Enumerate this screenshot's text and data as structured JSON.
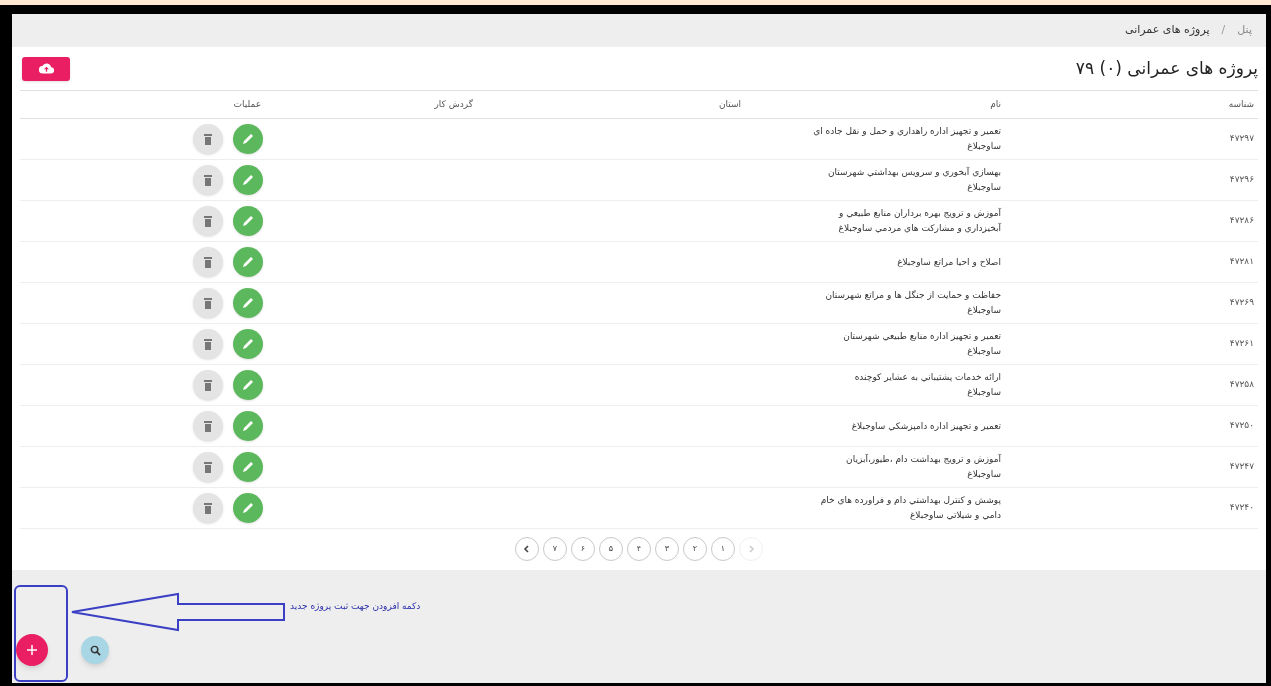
{
  "breadcrumb": [
    {
      "label": "پنل"
    },
    {
      "label": "پروژه های عمرانی",
      "separator": "/"
    }
  ],
  "title": "پروژه های عمرانی (۰) ۷۹",
  "table": {
    "columns": [
      "شناسه",
      "نام",
      "استان",
      "گردش کار",
      "عملیات"
    ],
    "rows": [
      {
        "id": "۴۷۲۹۷",
        "name_lines": [
          "تعمیر و تجهیز اداره راهداري و حمل و نقل جاده اي",
          "ساوجبلاغ"
        ]
      },
      {
        "id": "۴۷۲۹۶",
        "name_lines": [
          "بهسازي آبخوري و سرويس بهداشتي شهرستان",
          "ساوجبلاغ"
        ]
      },
      {
        "id": "۴۷۲۸۶",
        "name_lines": [
          "آموزش و ترويج بهره برداران منابع طبيعي و",
          "آبخيزداري و مشاركت هاي مردمي ساوجبلاغ"
        ]
      },
      {
        "id": "۴۷۲۸۱",
        "name_lines": [
          "اصلاح و احيا مراتع ساوجبلاغ"
        ]
      },
      {
        "id": "۴۷۲۶۹",
        "name_lines": [
          "حفاظت و حمايت از جنگل ها و مراتع شهرستان",
          "ساوجبلاغ"
        ]
      },
      {
        "id": "۴۷۲۶۱",
        "name_lines": [
          "تعمير و تجهيز اداره منابع طبيعي شهرستان",
          "ساوجبلاغ"
        ]
      },
      {
        "id": "۴۷۲۵۸",
        "name_lines": [
          "ارائه خدمات پشتيباني به عشاير كوچنده",
          "ساوجبلاغ"
        ]
      },
      {
        "id": "۴۷۲۵۰",
        "name_lines": [
          "تعمير و تجهيز اداره دامپزشكي ساوجبلاغ"
        ]
      },
      {
        "id": "۴۷۲۴۷",
        "name_lines": [
          "آموزش و ترويج بهداشت دام ،طيور،آبزيان",
          "ساوجبلاغ"
        ]
      },
      {
        "id": "۴۷۲۴۰",
        "name_lines": [
          "پوشش و كنترل بهداشتي دام و فراورده هاي خام",
          "دامي و شيلاتي ساوجبلاغ"
        ]
      }
    ]
  },
  "pagination": [
    {
      "kind": "next",
      "disabled": true
    },
    {
      "kind": "page",
      "label": "۱"
    },
    {
      "kind": "page",
      "label": "۲"
    },
    {
      "kind": "page",
      "label": "۳"
    },
    {
      "kind": "page",
      "label": "۴"
    },
    {
      "kind": "page",
      "label": "۵"
    },
    {
      "kind": "page",
      "label": "۶"
    },
    {
      "kind": "page",
      "label": "۷"
    },
    {
      "kind": "prev",
      "disabled": false
    }
  ],
  "annotation": {
    "text": "دکمه افزودن جهت ثبت پروژه جدید"
  }
}
